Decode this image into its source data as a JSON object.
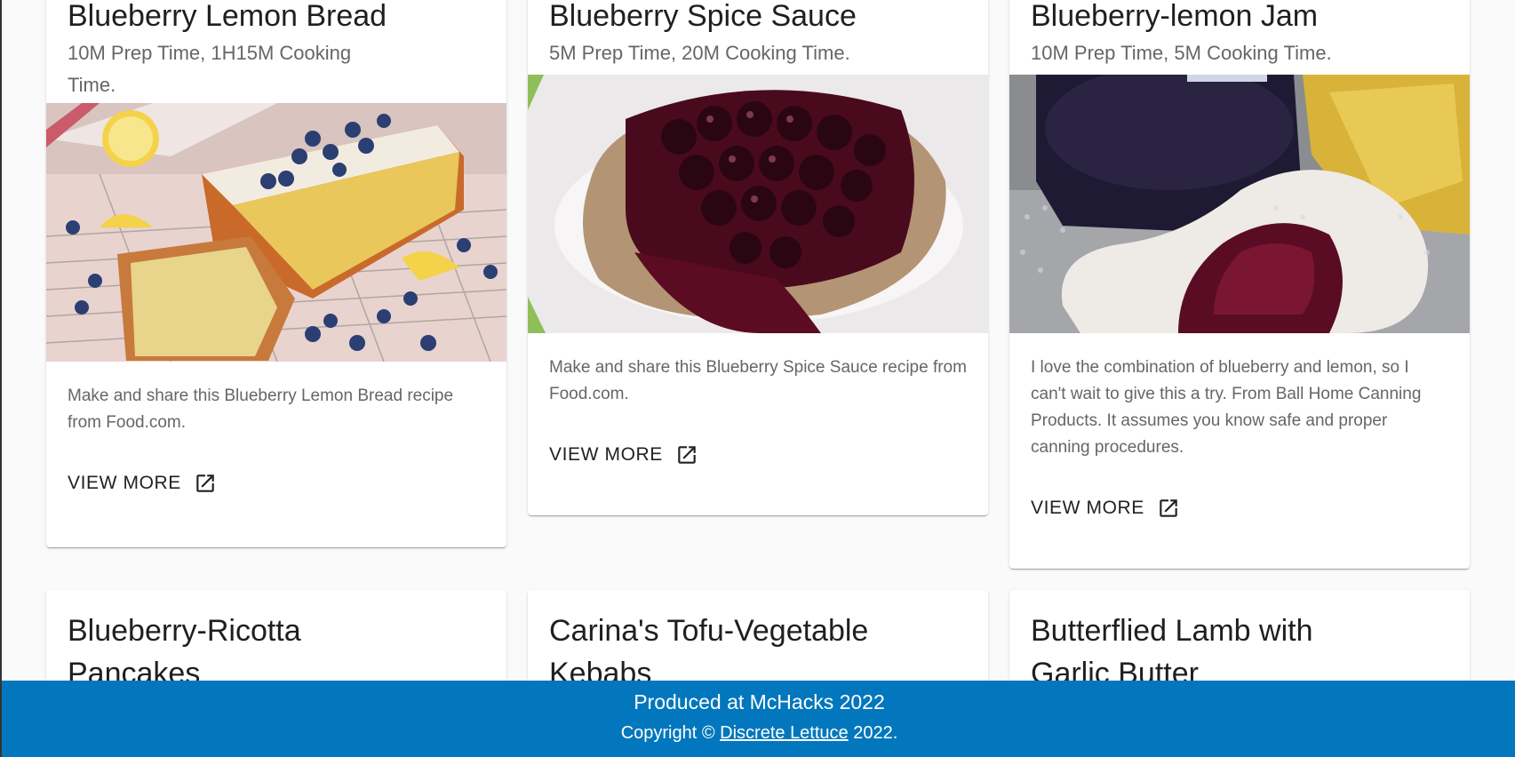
{
  "cards_row1": [
    {
      "title": "Blueberry Lemon Bread",
      "subtitle": "10M Prep Time, 1H15M Cooking Time.",
      "description": "Make and share this Blueberry Lemon Bread recipe from Food.com.",
      "button": "VIEW MORE",
      "image_alt": "blueberry-lemon-bread-photo"
    },
    {
      "title": "Blueberry Spice Sauce",
      "subtitle": "5M Prep Time, 20M Cooking Time.",
      "description": "Make and share this Blueberry Spice Sauce recipe from Food.com.",
      "button": "VIEW MORE",
      "image_alt": "blueberry-spice-sauce-photo"
    },
    {
      "title": "Blueberry-lemon Jam",
      "subtitle": "10M Prep Time, 5M Cooking Time.",
      "description": "I love the combination of blueberry and lemon, so I can't wait to give this a try. From Ball Home Canning Products. It assumes you know safe and proper canning procedures.",
      "button": "VIEW MORE",
      "image_alt": "blueberry-lemon-jam-photo"
    }
  ],
  "cards_row2": [
    {
      "title": "Blueberry-Ricotta Pancakes"
    },
    {
      "title": "Carina's Tofu-Vegetable Kebabs"
    },
    {
      "title": "Butterflied Lamb with Garlic Butter"
    }
  ],
  "icons": {
    "view_more": "open-in-new-icon"
  },
  "colors": {
    "footer_bg": "#0277bd"
  },
  "footer": {
    "line1": "Produced at McHacks 2022",
    "copyright_prefix": "Copyright ©",
    "link_text": "Discrete Lettuce",
    "copyright_suffix": "2022."
  }
}
